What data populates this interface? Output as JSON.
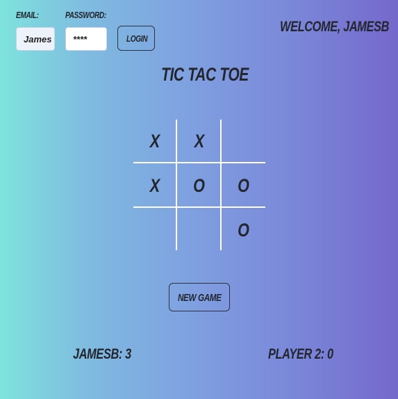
{
  "auth": {
    "email_label": "EMAIL:",
    "password_label": "PASSWORD:",
    "email_value": "James",
    "password_value": "****",
    "login_label": "LOGIN"
  },
  "welcome_text": "WELCOME, JAMESB",
  "game_title": "TIC TAC TOE",
  "board": {
    "cells": [
      "X",
      "X",
      "",
      "X",
      "O",
      "O",
      "",
      "",
      "O"
    ]
  },
  "new_game_label": "NEW GAME",
  "scores": {
    "player1": "JAMESB: 3",
    "player2": "PLAYER 2: 0"
  }
}
